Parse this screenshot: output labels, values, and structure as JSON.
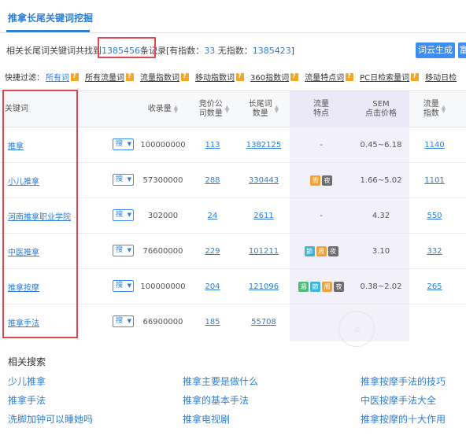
{
  "header": {
    "title": "推拿长尾关键词挖掘"
  },
  "summary": {
    "prefix": "相关长尾词关键词共找到",
    "count": "1385456",
    "suffix": "条记录[有指数：",
    "with_index": "33",
    "without_label": " 无指数：",
    "without_index": "1385423",
    "end": "]"
  },
  "buttons": {
    "generate": "词云生成",
    "more": "富"
  },
  "filters": {
    "label": "快捷过滤：",
    "items": [
      "所有词",
      "所有流量词",
      "流量指数词",
      "移动指数词",
      "360指数词",
      "流量特点词",
      "PC日检索量词",
      "移动日检"
    ]
  },
  "table": {
    "headers": {
      "keyword": "关键词",
      "volume": "收录量",
      "competitors": [
        "竞价公",
        "司数量"
      ],
      "longtail": [
        "长尾词",
        "数量"
      ],
      "traffic_feature": [
        "流量",
        "特点"
      ],
      "sem": [
        "SEM",
        "点击价格"
      ],
      "traffic_index": [
        "流量",
        "指数"
      ]
    },
    "search_label": "搜",
    "rows": [
      {
        "keyword": "推拿",
        "volume": "100000000",
        "competitors": "113",
        "longtail": "1382125",
        "feature": "-",
        "badges": [],
        "sem": "0.45~6.18",
        "index": "1140"
      },
      {
        "keyword": "小儿推拿",
        "volume": "57300000",
        "competitors": "288",
        "longtail": "330443",
        "feature": "",
        "badges": [
          "周",
          "夜"
        ],
        "sem": "1.66~5.02",
        "index": "1101"
      },
      {
        "keyword": "河南推拿职业学院",
        "volume": "302000",
        "competitors": "24",
        "longtail": "2611",
        "feature": "-",
        "badges": [],
        "sem": "4.32",
        "index": "550"
      },
      {
        "keyword": "中医推拿",
        "volume": "76600000",
        "competitors": "229",
        "longtail": "101211",
        "feature": "",
        "badges": [
          "節",
          "周",
          "夜"
        ],
        "sem": "3.10",
        "index": "332"
      },
      {
        "keyword": "推拿按摩",
        "volume": "100000000",
        "competitors": "204",
        "longtail": "121096",
        "feature": "",
        "badges": [
          "週",
          "節",
          "周",
          "夜"
        ],
        "sem": "0.38~2.02",
        "index": "265"
      },
      {
        "keyword": "推拿手法",
        "volume": "66900000",
        "competitors": "185",
        "longtail": "55708",
        "feature": "",
        "badges": [],
        "sem": "",
        "index": ""
      }
    ]
  },
  "related": {
    "title": "相关搜索",
    "items": [
      "少儿推拿",
      "推拿主要是做什么",
      "推拿按摩手法的技巧",
      "推拿手法",
      "推拿的基本手法",
      "中医按摩手法大全",
      "洗脚加钟可以睡她吗",
      "推拿电视剧",
      "推拿按摩的十大作用"
    ]
  },
  "colors": {
    "accent": "#2f7fd6",
    "button": "#3d8ef0",
    "highlight_box": "#e2464f",
    "help_icon": "#f4a623",
    "badge_week": "#f0a235",
    "badge_night": "#6d6d6d",
    "badge_holiday": "#3fb6d8",
    "badge_weekend": "#4cbd75"
  }
}
